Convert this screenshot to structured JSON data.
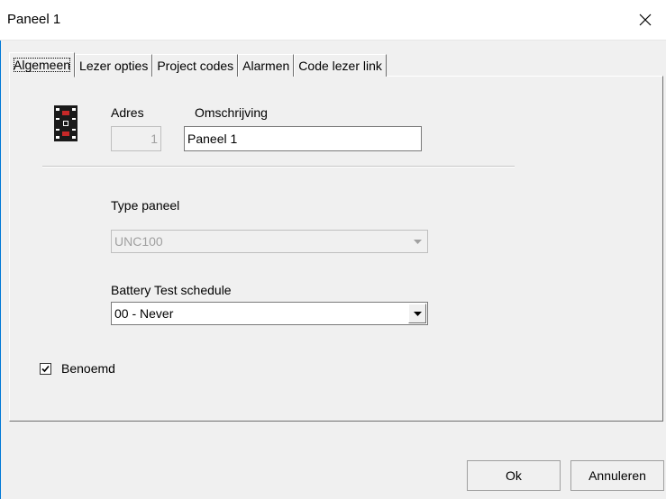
{
  "window": {
    "title": "Paneel 1"
  },
  "tabs": [
    {
      "label": "Algemeen",
      "active": true
    },
    {
      "label": "Lezer opties",
      "active": false
    },
    {
      "label": "Project codes",
      "active": false
    },
    {
      "label": "Alarmen",
      "active": false
    },
    {
      "label": "Code lezer link",
      "active": false
    }
  ],
  "general": {
    "adres_label": "Adres",
    "adres_value": "1",
    "omschrijving_label": "Omschrijving",
    "omschrijving_value": "Paneel 1",
    "type_label": "Type paneel",
    "type_value": "UNC100",
    "battery_label": "Battery Test schedule",
    "battery_value": "00 - Never",
    "benoemd_label": "Benoemd",
    "benoemd_checked": true
  },
  "buttons": {
    "ok": "Ok",
    "cancel": "Annuleren"
  },
  "colors": {
    "accent": "#0078d7",
    "dialog_bg": "#f0f0f0"
  },
  "icons": {
    "panel": "panel-board-icon",
    "close": "close-icon",
    "dropdown": "dropdown-arrow-icon",
    "check": "checkmark-icon"
  }
}
